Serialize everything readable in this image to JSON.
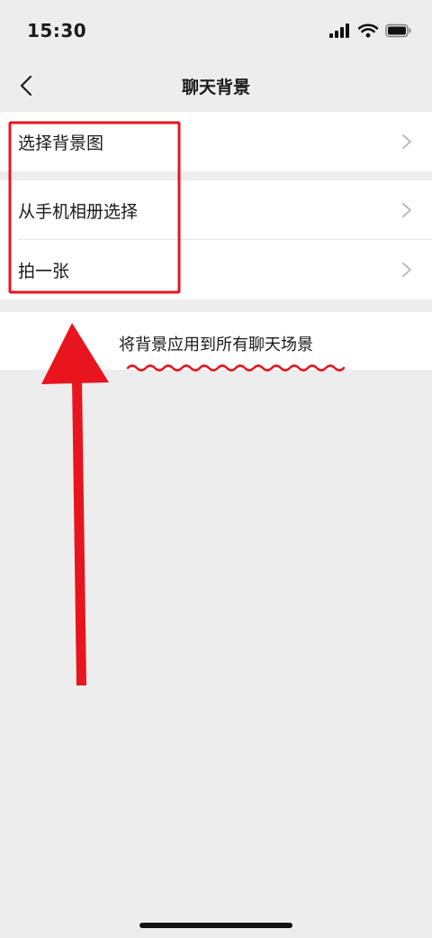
{
  "status_bar": {
    "time": "15:30",
    "icons": [
      "cellular-signal-icon",
      "wifi-icon",
      "battery-icon"
    ]
  },
  "nav": {
    "back_icon": "chevron-left-icon",
    "title": "聊天背景"
  },
  "menu": {
    "group1": [
      {
        "label": "选择背景图",
        "icon": "chevron-right-icon"
      }
    ],
    "group2": [
      {
        "label": "从手机相册选择",
        "icon": "chevron-right-icon"
      },
      {
        "label": "拍一张",
        "icon": "chevron-right-icon"
      }
    ]
  },
  "apply_all": {
    "label": "将背景应用到所有聊天场景"
  },
  "annotation": {
    "color": "#e8141e",
    "shapes": [
      "highlight-box",
      "wavy-underline",
      "pointing-arrow"
    ]
  },
  "colors": {
    "page_background": "#ededed",
    "cell_background": "#ffffff",
    "text": "#1a1a1a",
    "chevron": "#b2b2b2"
  }
}
